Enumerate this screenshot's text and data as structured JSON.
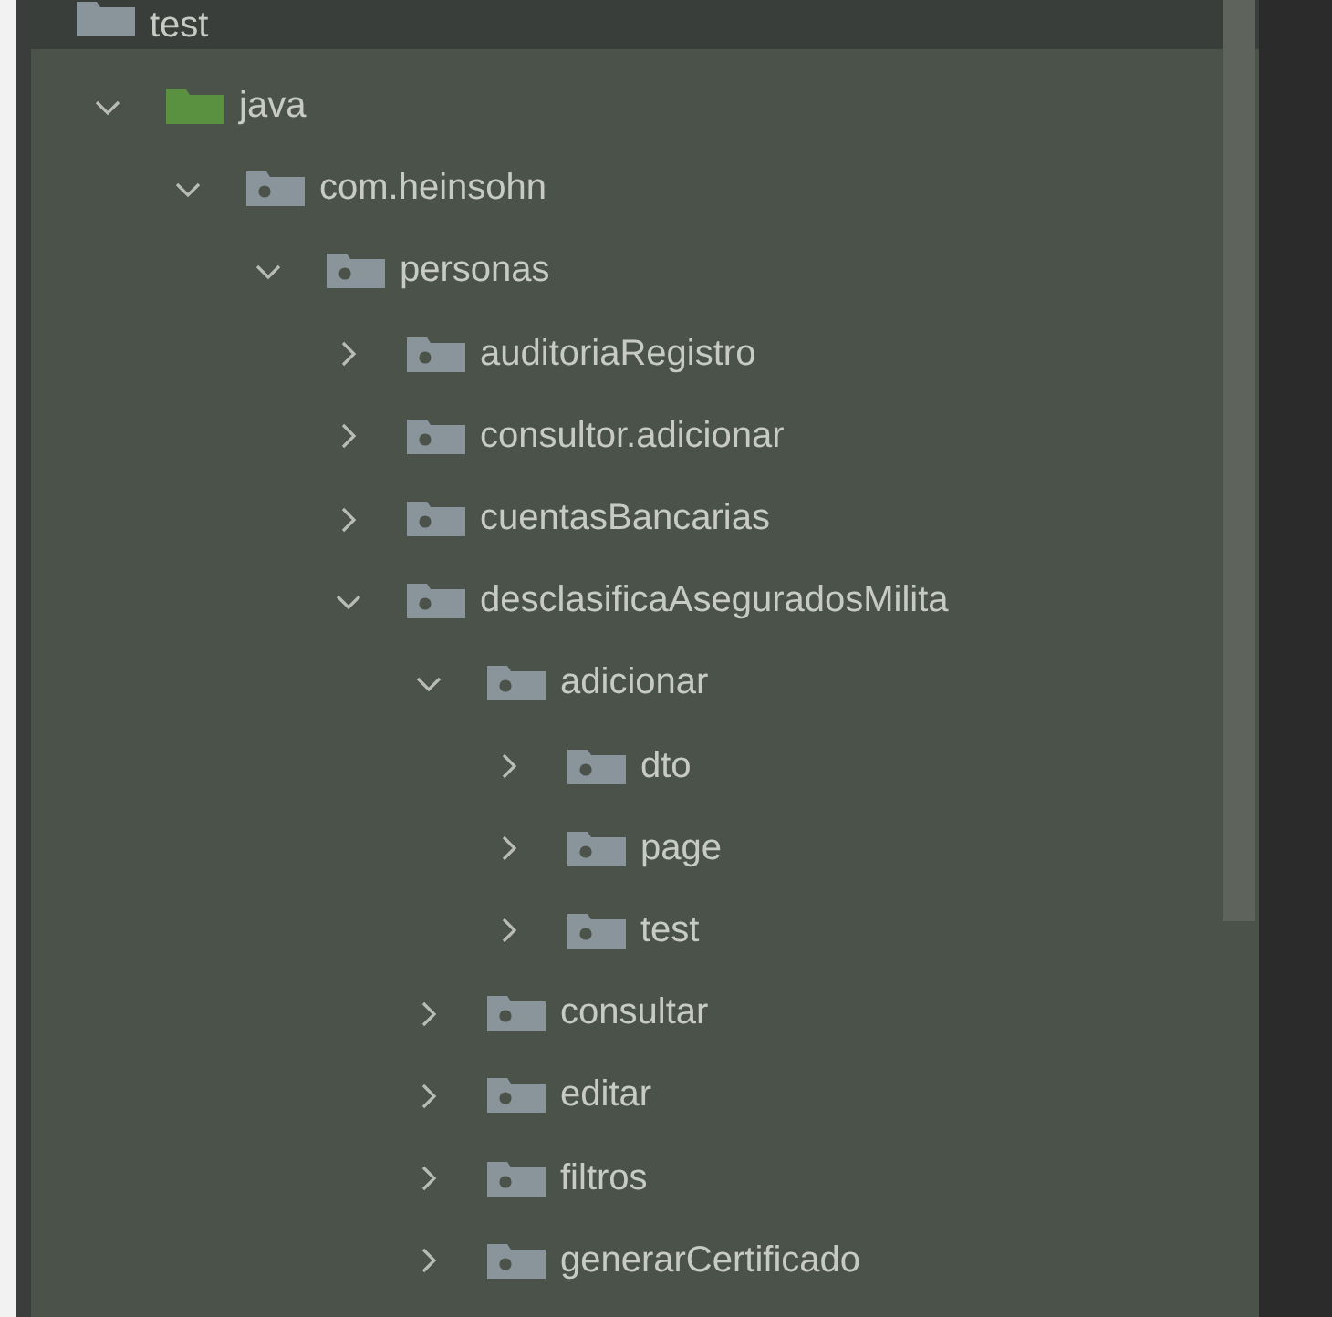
{
  "top_row": {
    "label": "test",
    "kind": "folder"
  },
  "tree": [
    {
      "label": "java",
      "kind": "source-root",
      "expanded": true,
      "children": [
        {
          "label": "com.heinsohn",
          "kind": "package",
          "expanded": true,
          "children": [
            {
              "label": "personas",
              "kind": "package",
              "expanded": true,
              "children": [
                {
                  "label": "auditoriaRegistro",
                  "kind": "package",
                  "expanded": false
                },
                {
                  "label": "consultor.adicionar",
                  "kind": "package",
                  "expanded": false
                },
                {
                  "label": "cuentasBancarias",
                  "kind": "package",
                  "expanded": false
                },
                {
                  "label": "desclasificaAseguradosMilita",
                  "kind": "package",
                  "expanded": true,
                  "children": [
                    {
                      "label": "adicionar",
                      "kind": "package",
                      "expanded": true,
                      "children": [
                        {
                          "label": "dto",
                          "kind": "package",
                          "expanded": false
                        },
                        {
                          "label": "page",
                          "kind": "package",
                          "expanded": false
                        },
                        {
                          "label": "test",
                          "kind": "package",
                          "expanded": false
                        }
                      ]
                    },
                    {
                      "label": "consultar",
                      "kind": "package",
                      "expanded": false
                    },
                    {
                      "label": "editar",
                      "kind": "package",
                      "expanded": false
                    },
                    {
                      "label": "filtros",
                      "kind": "package",
                      "expanded": false
                    },
                    {
                      "label": "generarCertificado",
                      "kind": "package",
                      "expanded": false
                    }
                  ]
                }
              ]
            }
          ]
        }
      ]
    }
  ]
}
